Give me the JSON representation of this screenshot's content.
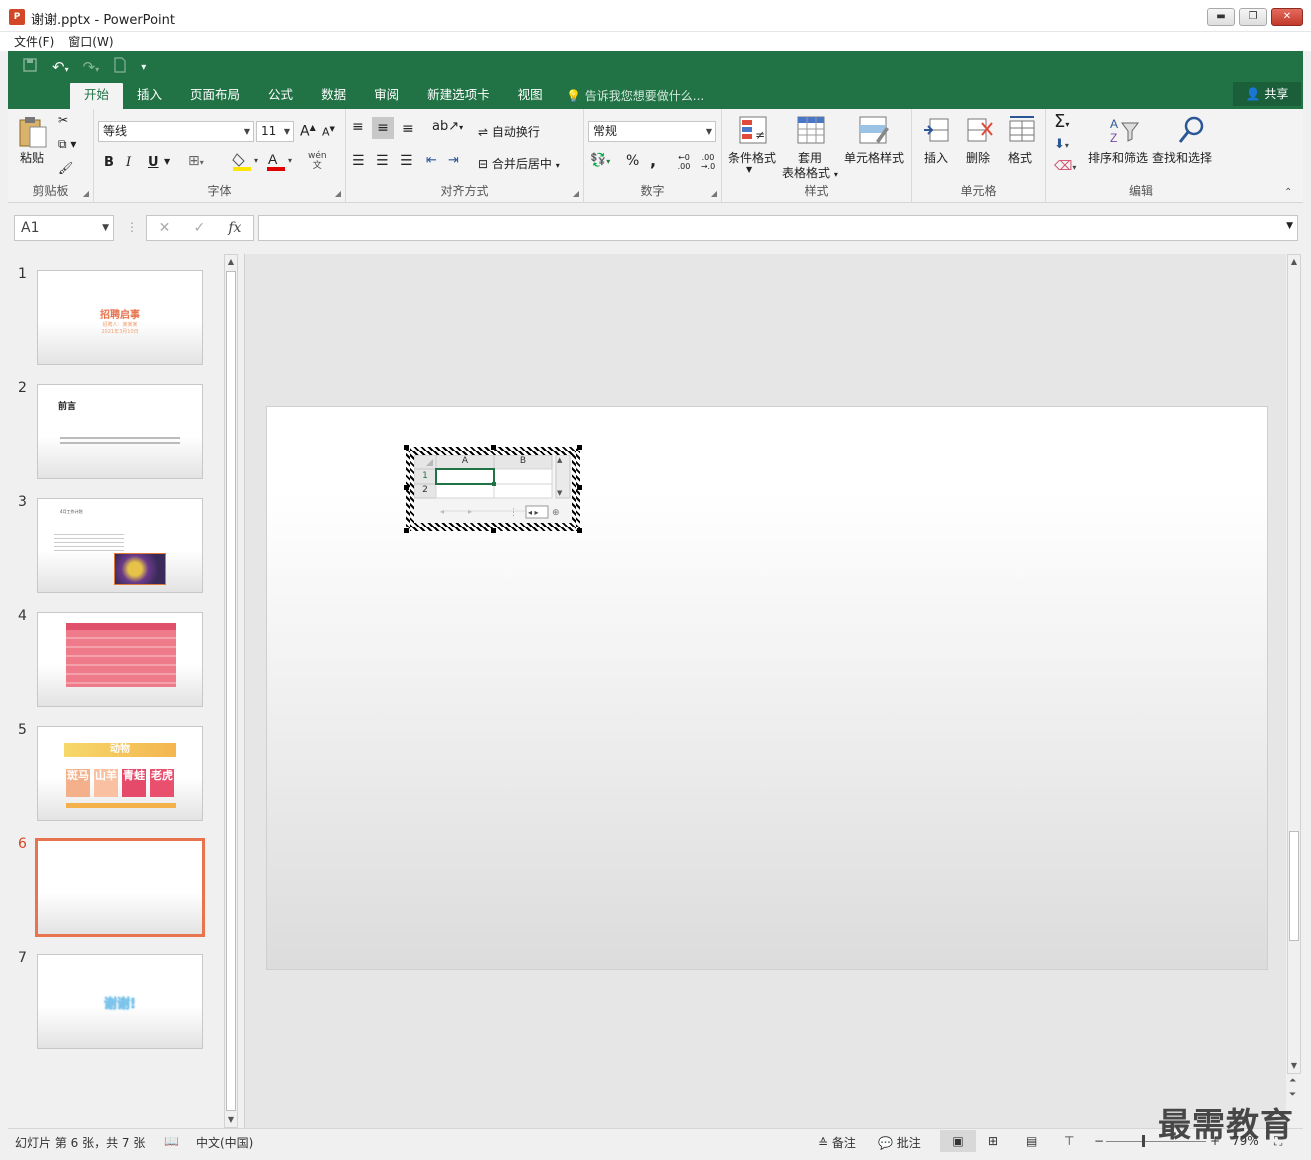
{
  "window": {
    "title": "谢谢.pptx - PowerPoint",
    "app_icon": "P",
    "controls": {
      "minimize": "▬",
      "maximize": "❐",
      "close": "✕"
    }
  },
  "menubar": {
    "items": [
      "文件(F)",
      "窗口(W)"
    ]
  },
  "ribbon_tabs": {
    "tabs": [
      "开始",
      "插入",
      "页面布局",
      "公式",
      "数据",
      "审阅",
      "新建选项卡",
      "视图"
    ],
    "tell_me": "告诉我您想要做什么...",
    "share": "共享"
  },
  "ribbon": {
    "clipboard": {
      "paste": "粘贴",
      "group": "剪贴板"
    },
    "font": {
      "name": "等线",
      "size": "11",
      "group": "字体",
      "bold": "B",
      "italic": "I",
      "underline": "U",
      "grow": "A",
      "shrink": "A",
      "font_color": "A",
      "phonetic_top": "wén",
      "phonetic_bottom": "文"
    },
    "alignment": {
      "wrap": "自动换行",
      "merge": "合并后居中",
      "group": "对齐方式"
    },
    "number": {
      "format": "常规",
      "percent": "%",
      "comma": ",",
      "group": "数字",
      "inc_decimal": "←0 .00",
      "dec_decimal": ".00 →.0"
    },
    "styles": {
      "conditional": "条件格式",
      "table_line1": "套用",
      "table_line2": "表格格式",
      "cell_styles": "单元格样式",
      "group": "样式"
    },
    "cells": {
      "insert": "插入",
      "delete": "删除",
      "format": "格式",
      "group": "单元格"
    },
    "editing": {
      "sum": "Σ",
      "sort_filter": "排序和筛选",
      "find_select": "查找和选择",
      "group": "编辑"
    }
  },
  "formula_bar": {
    "name_box": "A1",
    "cancel": "✕",
    "enter": "✓",
    "fx": "fx",
    "formula": ""
  },
  "slides": {
    "numbers": [
      "1",
      "2",
      "3",
      "4",
      "5",
      "6",
      "7"
    ],
    "active": 6,
    "slide1_title": "招聘启事",
    "slide1_sub": "招聘人：某某某",
    "slide1_date": "2021年3月10日",
    "slide2_title": "前言",
    "slide3_title": "4月工作计划",
    "slide5_title": "动物",
    "slide5_cards": [
      "斑马",
      "山羊",
      "青蛙",
      "老虎"
    ],
    "slide7_title": "谢谢!"
  },
  "embedded_sheet": {
    "columns": [
      "A",
      "B"
    ],
    "rows": [
      "1",
      "2"
    ]
  },
  "statusbar": {
    "slide_info": "幻灯片 第 6 张，共 7 张",
    "language": "中文(中国)",
    "notes": "备注",
    "comments": "批注",
    "zoom": "79%"
  },
  "watermark": "最需教育",
  "colors": {
    "ribbon_green": "#217346",
    "active_thumb": "#e8734f",
    "powerpoint": "#d24726"
  }
}
